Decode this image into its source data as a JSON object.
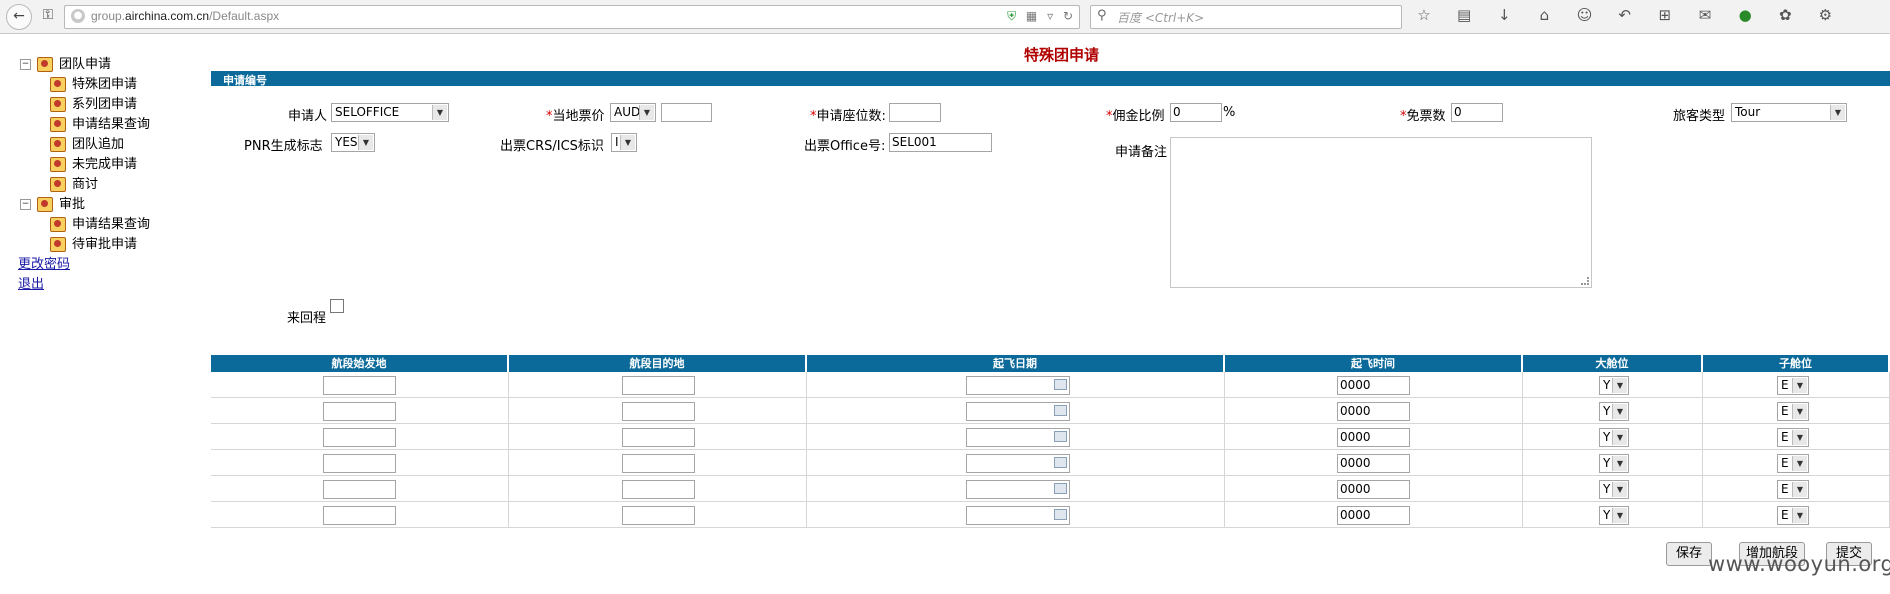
{
  "browser": {
    "url_host_prefix": "group.",
    "url_host": "airchina.com.cn",
    "url_path": "/Default.aspx",
    "search_placeholder": "百度 <Ctrl+K>"
  },
  "sidebar": {
    "groups": [
      {
        "label": "团队申请",
        "items": [
          "特殊团申请",
          "系列团申请",
          "申请结果查询",
          "团队追加",
          "未完成申请",
          "商讨"
        ]
      },
      {
        "label": "审批",
        "items": [
          "申请结果查询",
          "待审批申请"
        ]
      }
    ],
    "links": [
      "更改密码",
      "退出"
    ]
  },
  "form": {
    "title": "特殊团申请",
    "section": "申请编号",
    "applicant_label": "申请人",
    "applicant_value": "SELOFFICE",
    "local_fare_label": "当地票价",
    "currency_value": "AUD",
    "local_fare_value": "",
    "seats_label": "申请座位数:",
    "seats_value": "",
    "commission_label": "佣金比例",
    "commission_value": "0",
    "commission_unit": "%",
    "free_tickets_label": "免票数",
    "free_tickets_value": "0",
    "pax_type_label": "旅客类型",
    "pax_type_value": "Tour",
    "pnr_label": "PNR生成标志",
    "pnr_value": "YES",
    "crs_label": "出票CRS/ICS标识",
    "crs_value": "I",
    "office_label": "出票Office号:",
    "office_value": "SEL001",
    "remarks_label": "申请备注",
    "round_trip_label": "来回程"
  },
  "segments": {
    "headers": [
      "航段始发地",
      "航段目的地",
      "起飞日期",
      "起飞时间",
      "大舱位",
      "子舱位"
    ],
    "rows": [
      {
        "origin": "",
        "dest": "",
        "date": "",
        "time": "0000",
        "cabin": "Y",
        "subcabin": "E"
      },
      {
        "origin": "",
        "dest": "",
        "date": "",
        "time": "0000",
        "cabin": "Y",
        "subcabin": "E"
      },
      {
        "origin": "",
        "dest": "",
        "date": "",
        "time": "0000",
        "cabin": "Y",
        "subcabin": "E"
      },
      {
        "origin": "",
        "dest": "",
        "date": "",
        "time": "0000",
        "cabin": "Y",
        "subcabin": "E"
      },
      {
        "origin": "",
        "dest": "",
        "date": "",
        "time": "0000",
        "cabin": "Y",
        "subcabin": "E"
      },
      {
        "origin": "",
        "dest": "",
        "date": "",
        "time": "0000",
        "cabin": "Y",
        "subcabin": "E"
      }
    ]
  },
  "buttons": {
    "save": "保存",
    "add_segment": "增加航段",
    "submit": "提交"
  },
  "watermark": "www.wooyun.org"
}
